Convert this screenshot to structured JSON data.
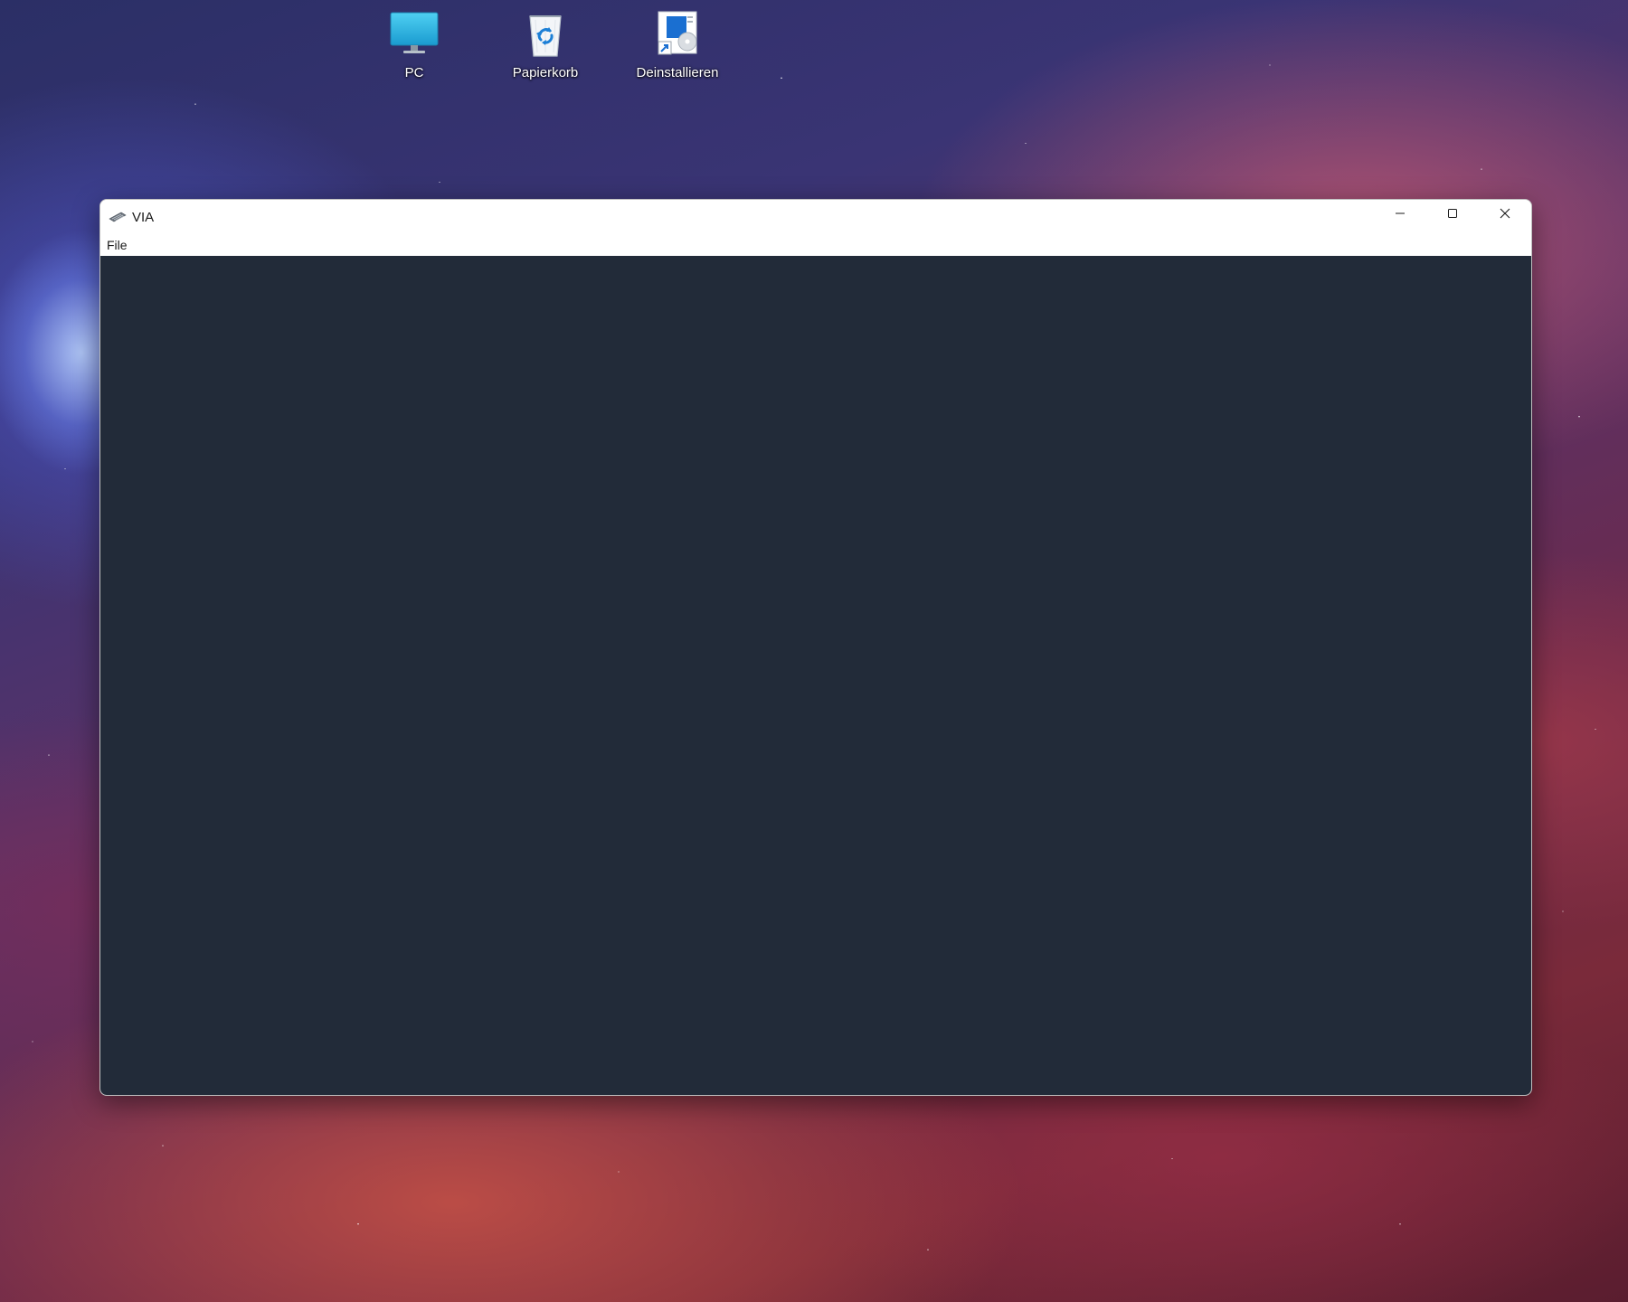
{
  "desktop": {
    "icons": [
      {
        "label": "PC",
        "icon": "pc-monitor-icon"
      },
      {
        "label": "Papierkorb",
        "icon": "recycle-bin-icon"
      },
      {
        "label": "Deinstallieren",
        "icon": "uninstall-shortcut-icon"
      }
    ]
  },
  "window": {
    "title": "VIA",
    "app_icon": "keyboard-icon",
    "menu": [
      {
        "label": "File"
      }
    ],
    "caption_buttons": {
      "minimize": "minimize-icon",
      "maximize": "maximize-icon",
      "close": "close-icon"
    },
    "content_background": "#222b39"
  }
}
